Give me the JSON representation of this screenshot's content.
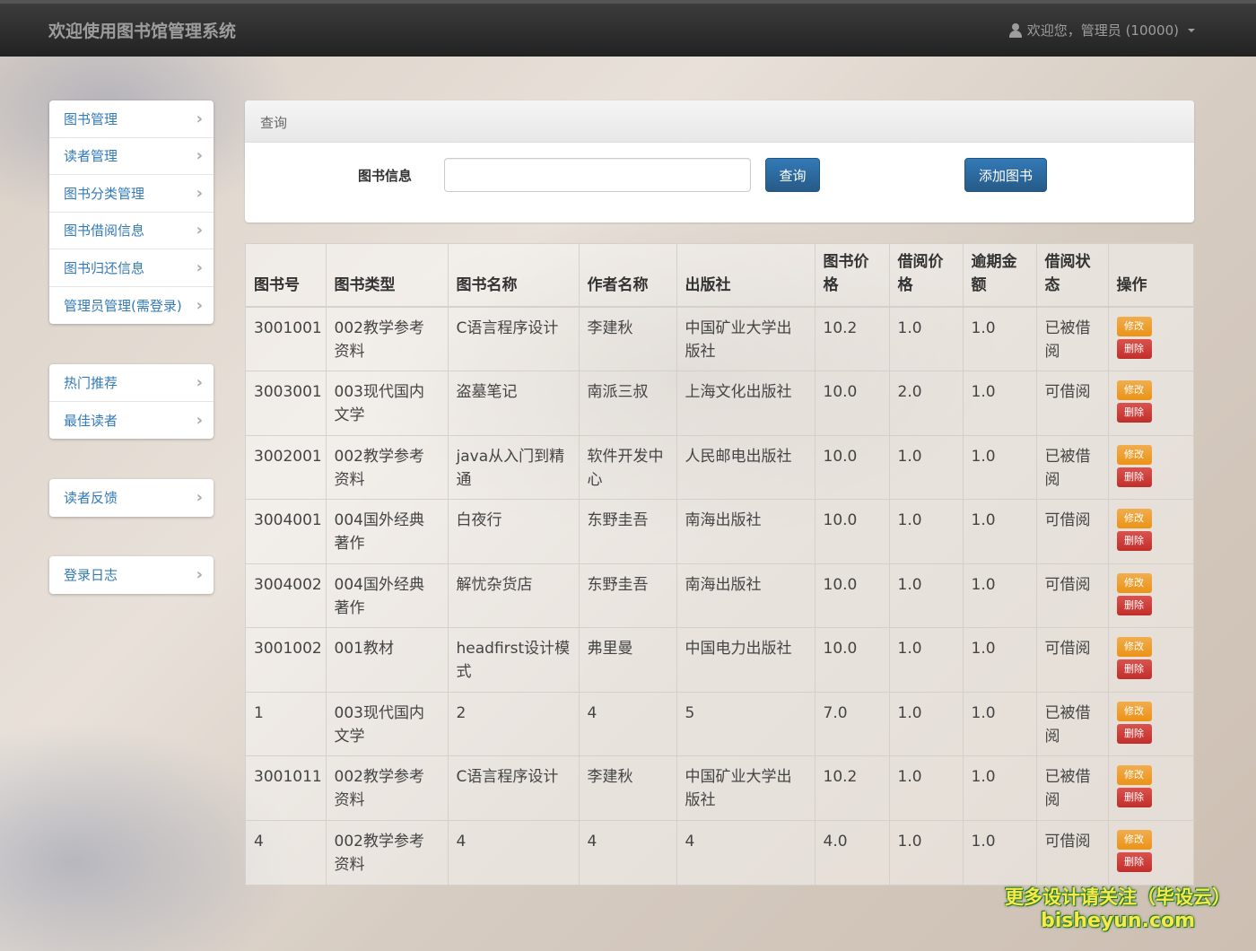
{
  "navbar": {
    "brand": "欢迎使用图书馆管理系统",
    "user": "欢迎您，管理员 (10000)"
  },
  "sidebar": {
    "group1": [
      {
        "label": "图书管理"
      },
      {
        "label": "读者管理"
      },
      {
        "label": "图书分类管理"
      },
      {
        "label": "图书借阅信息"
      },
      {
        "label": "图书归还信息"
      },
      {
        "label": "管理员管理(需登录)"
      }
    ],
    "group2": [
      {
        "label": "热门推荐"
      },
      {
        "label": "最佳读者"
      }
    ],
    "group3": [
      {
        "label": "读者反馈"
      }
    ],
    "group4": [
      {
        "label": "登录日志"
      }
    ]
  },
  "search": {
    "panel_title": "查询",
    "label": "图书信息",
    "value": "",
    "query_button": "查询",
    "add_button": "添加图书"
  },
  "table": {
    "headers": [
      "图书号",
      "图书类型",
      "图书名称",
      "作者名称",
      "出版社",
      "图书价格",
      "借阅价格",
      "逾期金额",
      "借阅状态",
      "操作"
    ],
    "edit_label": "修改",
    "delete_label": "删除",
    "rows": [
      [
        "3001001",
        "002教学参考资料",
        "C语言程序设计",
        "李建秋",
        "中国矿业大学出版社",
        "10.2",
        "1.0",
        "1.0",
        "已被借阅"
      ],
      [
        "3003001",
        "003现代国内文学",
        "盗墓笔记",
        "南派三叔",
        "上海文化出版社",
        "10.0",
        "2.0",
        "1.0",
        "可借阅"
      ],
      [
        "3002001",
        "002教学参考资料",
        "java从入门到精通",
        "软件开发中心",
        "人民邮电出版社",
        "10.0",
        "1.0",
        "1.0",
        "已被借阅"
      ],
      [
        "3004001",
        "004国外经典著作",
        "白夜行",
        "东野圭吾",
        "南海出版社",
        "10.0",
        "1.0",
        "1.0",
        "可借阅"
      ],
      [
        "3004002",
        "004国外经典著作",
        "解忧杂货店",
        "东野圭吾",
        "南海出版社",
        "10.0",
        "1.0",
        "1.0",
        "可借阅"
      ],
      [
        "3001002",
        "001教材",
        "headfirst设计模式",
        "弗里曼",
        "中国电力出版社",
        "10.0",
        "1.0",
        "1.0",
        "可借阅"
      ],
      [
        "1",
        "003现代国内文学",
        "2",
        "4",
        "5",
        "7.0",
        "1.0",
        "1.0",
        "已被借阅"
      ],
      [
        "3001011",
        "002教学参考资料",
        "C语言程序设计",
        "李建秋",
        "中国矿业大学出版社",
        "10.2",
        "1.0",
        "1.0",
        "已被借阅"
      ],
      [
        "4",
        "002教学参考资料",
        "4",
        "4",
        "4",
        "4.0",
        "1.0",
        "1.0",
        "可借阅"
      ]
    ]
  },
  "watermark": {
    "line1": "更多设计请关注（毕设云）",
    "line2": "bisheyun.com"
  }
}
